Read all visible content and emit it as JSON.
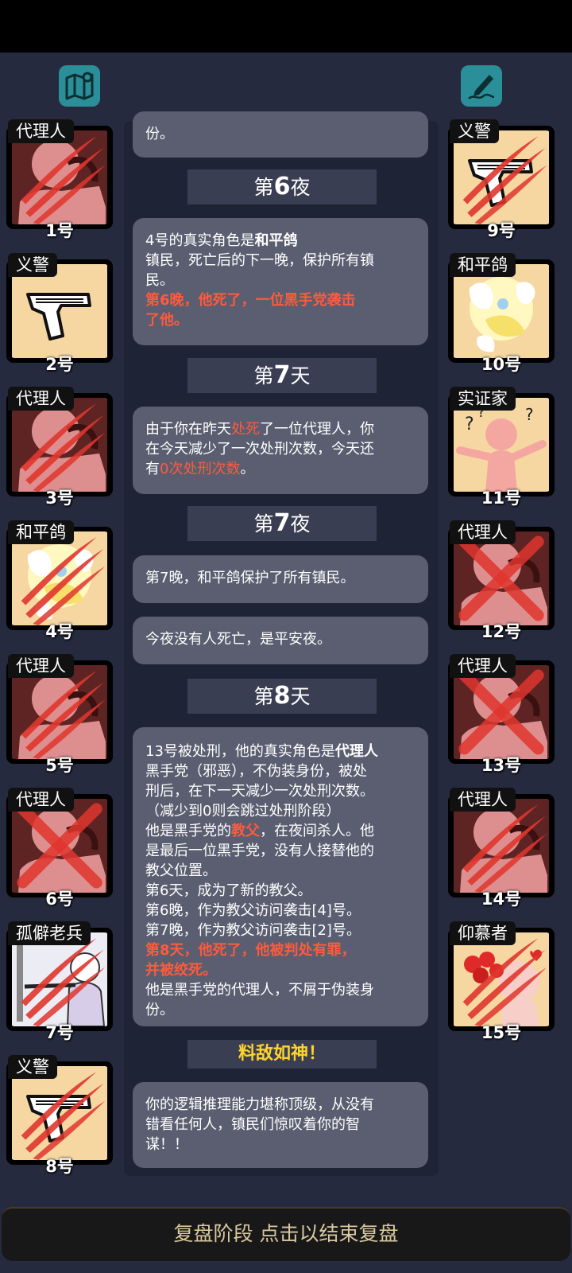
{
  "colors": {
    "background": "#262a3f",
    "bubble": "#5a5e70",
    "phase": "#3a3e52",
    "accent_red": "#ff5a3c",
    "gold": "#ffd42a",
    "teal": "#2a8f99"
  },
  "top_icons": {
    "left": "map-pin-icon",
    "right": "pen-icon"
  },
  "players_left": [
    {
      "role": "代理人",
      "number": "1号",
      "art": "shadow",
      "status": "claw"
    },
    {
      "role": "义警",
      "number": "2号",
      "art": "gun",
      "status": "alive"
    },
    {
      "role": "代理人",
      "number": "3号",
      "art": "shadow",
      "status": "claw"
    },
    {
      "role": "和平鸽",
      "number": "4号",
      "art": "dove",
      "status": "claw"
    },
    {
      "role": "代理人",
      "number": "5号",
      "art": "shadow",
      "status": "claw"
    },
    {
      "role": "代理人",
      "number": "6号",
      "art": "shadow",
      "status": "cross"
    },
    {
      "role": "孤僻老兵",
      "number": "7号",
      "art": "veteran",
      "status": "claw"
    },
    {
      "role": "义警",
      "number": "8号",
      "art": "gun",
      "status": "claw"
    }
  ],
  "players_right": [
    {
      "role": "义警",
      "number": "9号",
      "art": "gun",
      "status": "claw"
    },
    {
      "role": "和平鸽",
      "number": "10号",
      "art": "dove",
      "status": "alive"
    },
    {
      "role": "实证家",
      "number": "11号",
      "art": "empiricist",
      "status": "alive"
    },
    {
      "role": "代理人",
      "number": "12号",
      "art": "shadow",
      "status": "cross"
    },
    {
      "role": "代理人",
      "number": "13号",
      "art": "shadow",
      "status": "cross"
    },
    {
      "role": "代理人",
      "number": "14号",
      "art": "shadow",
      "status": "claw"
    },
    {
      "role": "仰慕者",
      "number": "15号",
      "art": "admirer",
      "status": "claw"
    }
  ],
  "log": {
    "partial_top": "份。",
    "night6_title_pre": "第",
    "night6_num": "6",
    "night6_title_post": "夜",
    "night6_msg": {
      "l1_pre": "4号的真实角色是",
      "l1_role": "和平鸽",
      "l2": "镇民，死亡后的下一晚，保护所有镇",
      "l3": "民。",
      "l4": "第6晚，他死了，一位黑手党袭击",
      "l5": "了他。"
    },
    "day7_title_pre": "第",
    "day7_num": "7",
    "day7_title_post": "天",
    "day7_msg": {
      "l1_pre": "由于你在昨天",
      "l1_red": "处死",
      "l1_post": "了一位代理人，你",
      "l2": "在今天减少了一次处刑次数，今天还",
      "l3_pre": "有",
      "l3_red": "0次处刑次数",
      "l3_post": "。"
    },
    "night7_title_pre": "第",
    "night7_num": "7",
    "night7_title_post": "夜",
    "night7_msg1": "第7晚，和平鸽保护了所有镇民。",
    "night7_msg2": "今夜没有人死亡，是平安夜。",
    "day8_title_pre": "第",
    "day8_num": "8",
    "day8_title_post": "天",
    "day8_msg": {
      "l1_pre": "13号被处刑，他的真实角色是",
      "l1_role": "代理人",
      "l2": "黑手党（邪恶），不伪装身份，被处",
      "l3": "刑后，在下一天减少一次处刑次数。",
      "l4": "（减少到0则会跳过处刑阶段）",
      "l5_pre": "他是黑手党的",
      "l5_red": "教父",
      "l5_post": "，在夜间杀人。他",
      "l6": "是最后一位黑手党，没有人接替他的",
      "l7": "教父位置。",
      "l8": "第6天，成为了新的教父。",
      "l9": "第6晚，作为教父访问袭击[4]号。",
      "l10": "第7晚，作为教父访问袭击[2]号。",
      "l11": "第8天，他死了，他被判处有罪，",
      "l12": "并被绞死。",
      "l13": "他是黑手党的代理人，不屑于伪装身",
      "l14": "份。"
    },
    "verdict_title": "料敌如神！",
    "final_msg": {
      "l1": "你的逻辑推理能力堪称顶级，从没有",
      "l2": "错看任何人，镇民们惊叹着你的智",
      "l3": "谋！！"
    }
  },
  "bottom_button": "复盘阶段 点击以结束复盘"
}
